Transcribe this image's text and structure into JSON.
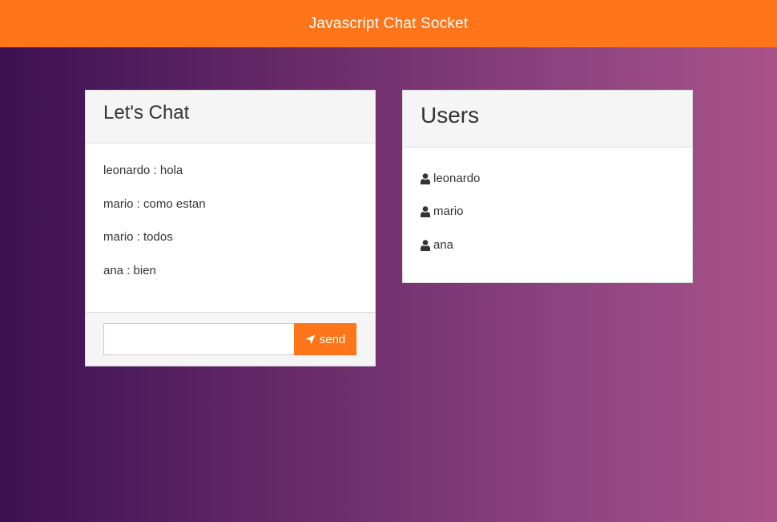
{
  "header": {
    "title": "Javascript Chat Socket"
  },
  "chat": {
    "title": "Let's Chat",
    "messages": [
      {
        "text": "leonardo : hola"
      },
      {
        "text": "mario : como estan"
      },
      {
        "text": "mario : todos"
      },
      {
        "text": "ana : bien"
      }
    ],
    "input_value": "",
    "input_placeholder": "",
    "send_label": "send",
    "send_icon": "location-arrow-icon"
  },
  "users": {
    "title": "Users",
    "user_icon": "user-icon",
    "list": [
      {
        "name": "leonardo"
      },
      {
        "name": "mario"
      },
      {
        "name": "ana"
      }
    ]
  },
  "colors": {
    "accent": "#ff7519",
    "background_start": "#3b1152",
    "background_end": "#a9528a"
  }
}
